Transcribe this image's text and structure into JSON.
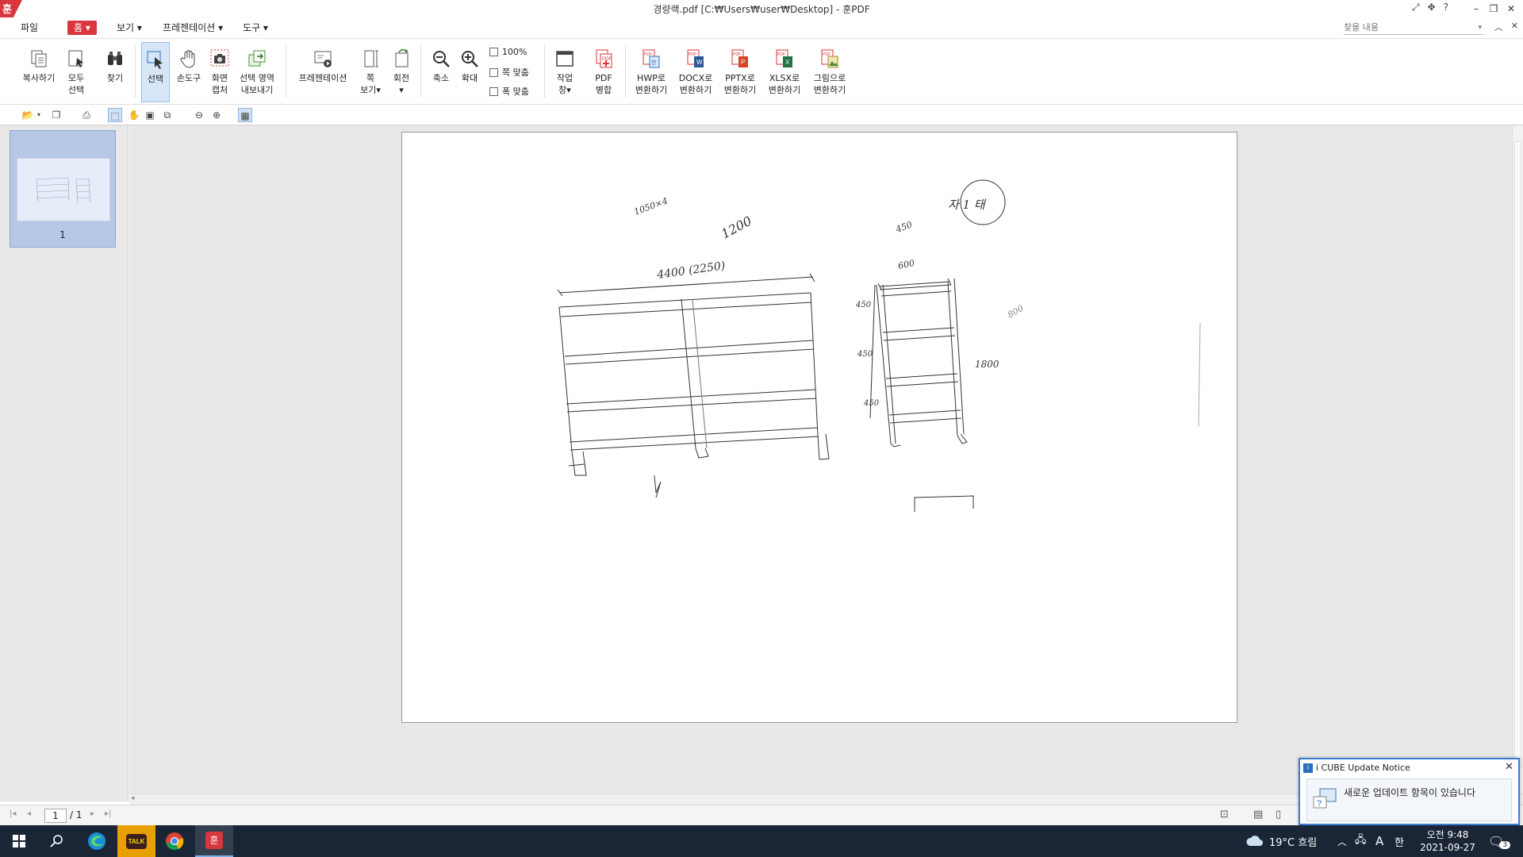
{
  "window": {
    "title": "경량랙.pdf [C:₩Users₩user₩Desktop] - 훈PDF"
  },
  "menu": {
    "file": "파일",
    "home": "홈",
    "view": "보기",
    "presentation": "프레젠테이션",
    "tools": "도구"
  },
  "search": {
    "placeholder": "찾을 내용"
  },
  "ribbon": {
    "copy": "복사하기",
    "select_all_1": "모두",
    "select_all_2": "선택",
    "find": "찾기",
    "select": "선택",
    "hand_tool": "손도구",
    "capture_1": "화면",
    "capture_2": "캡처",
    "export_1": "선택 영역",
    "export_2": "내보내기",
    "presentation": "프레젠테이션",
    "page_view_1": "쪽",
    "page_view_2": "보기",
    "rotate": "회전",
    "zoom_out": "축소",
    "zoom_in": "확대",
    "zoom_100": "100%",
    "fit_page": "쪽 맞춤",
    "fit_width": "폭 맞춤",
    "window_1": "작업",
    "window_2": "창",
    "merge_1": "PDF",
    "merge_2": "병합",
    "to_hwp_1": "HWP로",
    "to_docx_1": "DOCX로",
    "to_pptx_1": "PPTX로",
    "to_xlsx_1": "XLSX로",
    "to_img_1": "그림으로",
    "convert": "변환하기"
  },
  "thumbnail": {
    "page_label": "1"
  },
  "status": {
    "current_page": "1",
    "total_pages": "/ 1"
  },
  "drawing": {
    "top_note": "1050×4",
    "dim_1200": "1200",
    "dim_width": "4400 (2250)",
    "circle_note": "자 1 태",
    "dim_450": "450",
    "dim_top_small": "600",
    "dim_side_1800": "1800",
    "dim_800": "800",
    "label_a": "450",
    "label_b": "450",
    "label_c": "450"
  },
  "taskbar": {
    "weather": "19°C 흐림",
    "ime": "A",
    "ime2": "한",
    "time_period": "오전 9:48",
    "date": "2021-09-27",
    "notif_count": "3"
  },
  "notice": {
    "title": "i CUBE Update Notice",
    "message": "새로운 업데이트 항목이 있습니다"
  }
}
